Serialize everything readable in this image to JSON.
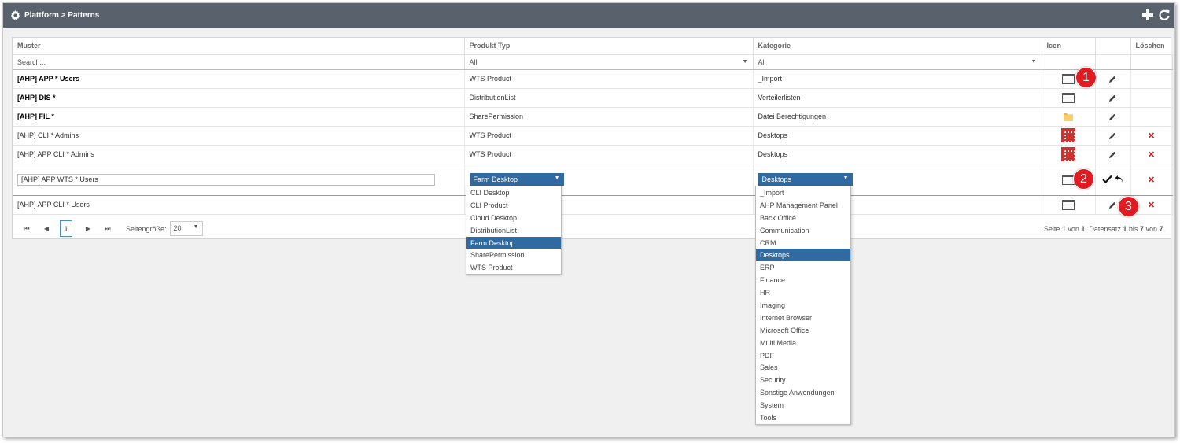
{
  "titlebar": {
    "title": "Plattform > Patterns",
    "icon": "gear-icon"
  },
  "toolbar": {
    "add_icon": "plus-icon",
    "refresh_icon": "refresh-icon"
  },
  "columns": {
    "muster": "Muster",
    "produkt_typ": "Produkt Typ",
    "kategorie": "Kategorie",
    "icon": "Icon",
    "actions": "",
    "loeschen": "Löschen"
  },
  "filters": {
    "search_placeholder": "Search...",
    "produkt_typ": "All",
    "kategorie": "All"
  },
  "rows": [
    {
      "muster": "[AHP] APP * Users",
      "produkt_typ": "WTS Product",
      "kategorie": "_Import",
      "icon": "window-icon",
      "deletable": false
    },
    {
      "muster": "[AHP] DIS *",
      "produkt_typ": "DistributionList",
      "kategorie": "Verteilerlisten",
      "icon": "window-icon",
      "deletable": false
    },
    {
      "muster": "[AHP] FIL *",
      "produkt_typ": "SharePermission",
      "kategorie": "Datei Berechtigungen",
      "icon": "folder-icon",
      "deletable": false
    },
    {
      "muster": "[AHP] CLI * Admins",
      "produkt_typ": "WTS Product",
      "kategorie": "Desktops",
      "icon": "app-icon",
      "deletable": true
    },
    {
      "muster": "[AHP] APP CLI * Admins",
      "produkt_typ": "WTS Product",
      "kategorie": "Desktops",
      "icon": "app-icon",
      "deletable": true
    }
  ],
  "edit_row": {
    "muster": "[AHP] APP WTS * Users",
    "produkt_typ": "Farm Desktop",
    "kategorie": "Desktops",
    "icon": "window-icon"
  },
  "last_row": {
    "muster": "[AHP] APP CLI * Users",
    "icon": "window-icon"
  },
  "produkt_typ_options": [
    "CLI Desktop",
    "CLI Product",
    "Cloud Desktop",
    "DistributionList",
    "Farm Desktop",
    "SharePermission",
    "WTS Product"
  ],
  "kategorie_options": [
    "_Import",
    "AHP Management Panel",
    "Back Office",
    "Communication",
    "CRM",
    "Desktops",
    "ERP",
    "Finance",
    "HR",
    "Imaging",
    "Internet Browser",
    "Microsoft Office",
    "Multi Media",
    "PDF",
    "Sales",
    "Security",
    "Sonstige Anwendungen",
    "System",
    "Tools"
  ],
  "pager": {
    "current_page": "1",
    "page_size_label": "Seitengröße:",
    "page_size": "20",
    "info_prefix": "Seite ",
    "page": "1",
    "of_text": " von ",
    "pages": "1",
    "records_text": ", Datensatz ",
    "from": "1",
    "to_text": " bis ",
    "to": "7",
    "total_text": " von ",
    "total": "7",
    "end": "."
  },
  "badges": [
    "1",
    "2",
    "3"
  ],
  "colors": {
    "titlebar": "#58616c",
    "selection": "#2f6aa1",
    "badge": "#e01b22",
    "delete": "#c02020"
  }
}
